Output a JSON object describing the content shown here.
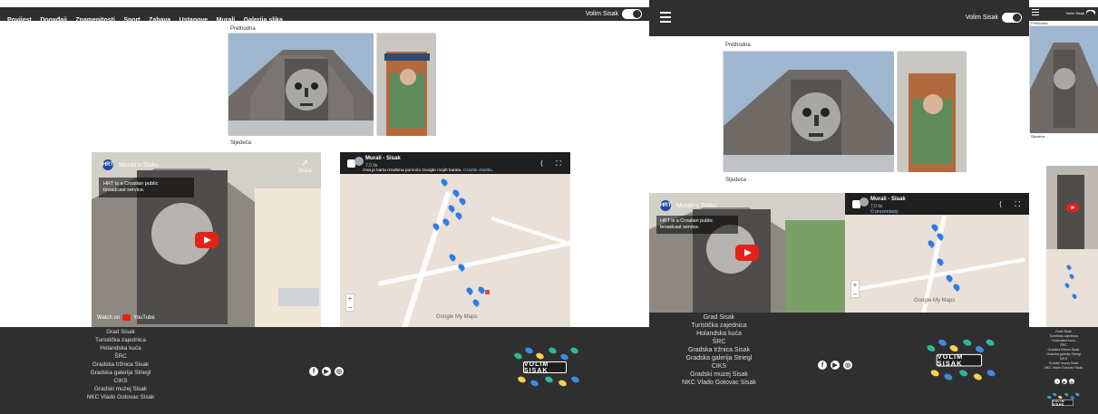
{
  "left": {
    "nav": [
      "Povijest",
      "Događaji",
      "Znamenitosti",
      "Sport",
      "Zabava",
      "Ustanove",
      "Murali",
      "Galerija slika"
    ],
    "volim_label": "Volim Sisak",
    "prev": "Prethodna",
    "next": "Sljedeća",
    "video_title": "Murali u Sisku",
    "share": "Share",
    "video_info_line1": "HRT is a Croatian public",
    "video_info_line2": "broadcast service.",
    "video_watch": "Watch on",
    "video_youtube": "YouTube",
    "map_title": "Murali - Sisak",
    "map_views": "7,0 tis",
    "map_note": "Ova je karta izrađena pomoću Google mojih karata.",
    "map_note_link": "Izradite vlastitu.",
    "map_google": "Google My Maps",
    "footer_links": [
      "Grad Sisak",
      "Turistička zajednica",
      "Holandska kuća",
      "ŠRC",
      "Gradska tržnica Sisak",
      "Gradska galerija Striegl",
      "CIKS",
      "Gradski muzej Sisak",
      "NKC Vlado Gotovac Sisak"
    ],
    "logo_text": "VOLIM SISAK"
  },
  "middle": {
    "volim_label": "Volim Sisak",
    "prev": "Prethodna",
    "next": "Sljedeća",
    "video_title": "Murali u Sisku",
    "video_info_line1": "HRT is a Croatian public",
    "video_info_line2": "broadcast service.",
    "map_title": "Murali - Sisak",
    "map_views": "7,0 tis",
    "map_desc": "O prezentaciji",
    "map_google": "Google My Maps",
    "footer_links": [
      "Grad Sisak",
      "Turistička zajednica",
      "Holandska kuća",
      "ŠRC",
      "Gradska tržnica Sisak",
      "Gradska galerija Striegl",
      "CIKS",
      "Gradski muzej Sisak",
      "NKC Vlado Gotovac Sisak"
    ],
    "logo_text": "VOLIM SISAK"
  },
  "right": {
    "volim_label": "Volim Sisak",
    "prev": "Prethodna",
    "next": "Sljedeća",
    "footer_links": [
      "Grad Sisak",
      "Turistička zajednica",
      "Holandska kuća",
      "ŠRC",
      "Gradska tržnica Sisak",
      "Gradska galerija Striegl",
      "CIKS",
      "Gradski muzej Sisak",
      "NKC Vlado Gotovac Sisak"
    ],
    "logo_text": "VOLIM SISAK"
  },
  "colors": {
    "dark": "#2f2f2f",
    "accent_blue": "#2e7ce8",
    "map_bg": "#e9e0d7",
    "youtube_red": "#e62117"
  }
}
